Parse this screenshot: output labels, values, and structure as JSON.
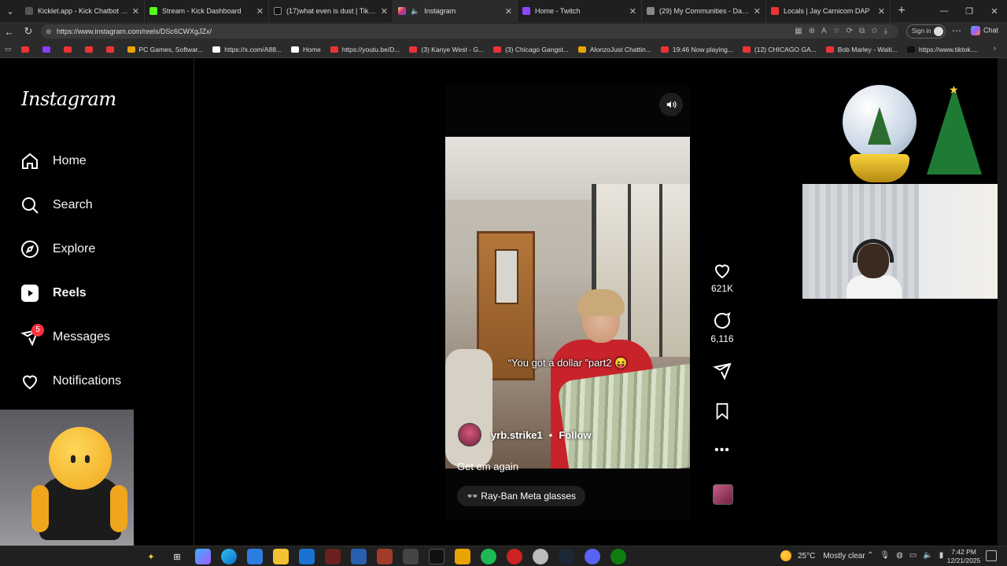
{
  "browser": {
    "tabs": [
      {
        "label": "Kicklet.app - Kick Chatbot and Ov",
        "color": "#555",
        "active": false
      },
      {
        "label": "Stream - Kick Dashboard",
        "color": "#53fc18",
        "active": false
      },
      {
        "label": "(17)what even is dust | TikTok",
        "color": "#111",
        "active": false
      },
      {
        "label": "Instagram",
        "color": "#e1306c",
        "active": true
      },
      {
        "label": "Home - Twitch",
        "color": "#9146ff",
        "active": false
      },
      {
        "label": "(29) My Communities - Dads Aga",
        "color": "#888",
        "active": false
      },
      {
        "label": "Locals | Jay Carnicom DAP",
        "color": "#e33",
        "active": false
      }
    ],
    "url": "https://www.instagram.com/reels/DSc6CWXgJZx/",
    "signin_label": "Sign in",
    "chat_label": "Chat",
    "bookmarks": [
      {
        "label": "",
        "color": "#e33"
      },
      {
        "label": "",
        "color": "#8a3cff"
      },
      {
        "label": "",
        "color": "#e33"
      },
      {
        "label": "",
        "color": "#e33"
      },
      {
        "label": "",
        "color": "#e33"
      },
      {
        "label": "PC Games, Softwar...",
        "color": "#e8a400"
      },
      {
        "label": "https://x.com/A88...",
        "color": "#fff"
      },
      {
        "label": "Home",
        "color": "#fff"
      },
      {
        "label": "https://youtu.be/D...",
        "color": "#e33"
      },
      {
        "label": "(3) Kanye West - G...",
        "color": "#e33"
      },
      {
        "label": "(3) Chicago Gangst...",
        "color": "#e33"
      },
      {
        "label": "AlonzoJust Chattin...",
        "color": "#e8a400"
      },
      {
        "label": "19:46 Now playing...",
        "color": "#e33"
      },
      {
        "label": "(12) CHICAGO GA...",
        "color": "#e33"
      },
      {
        "label": "Bob Marley - Waiti...",
        "color": "#e33"
      },
      {
        "label": "https://www.tiktok....",
        "color": "#111"
      }
    ]
  },
  "sidebar": {
    "logo": "Instagram",
    "items": [
      {
        "label": "Home",
        "icon": "home-icon"
      },
      {
        "label": "Search",
        "icon": "search-icon"
      },
      {
        "label": "Explore",
        "icon": "explore-icon"
      },
      {
        "label": "Reels",
        "icon": "reels-icon"
      },
      {
        "label": "Messages",
        "icon": "messages-icon",
        "badge": "5"
      },
      {
        "label": "Notifications",
        "icon": "heart-icon"
      }
    ]
  },
  "reel": {
    "overlay_text": "“You got a dollar ”part2 😝",
    "author": "yrb.strike1",
    "separator": "•",
    "follow_label": "Follow",
    "caption": "Get em again",
    "product_tag": "👓 Ray-Ban Meta glasses",
    "likes": "621K",
    "comments": "6,116"
  },
  "taskbar": {
    "weather_temp": "25°C",
    "weather_text": "Mostly clear",
    "time": "7:42 PM",
    "date": "12/21/2025"
  }
}
